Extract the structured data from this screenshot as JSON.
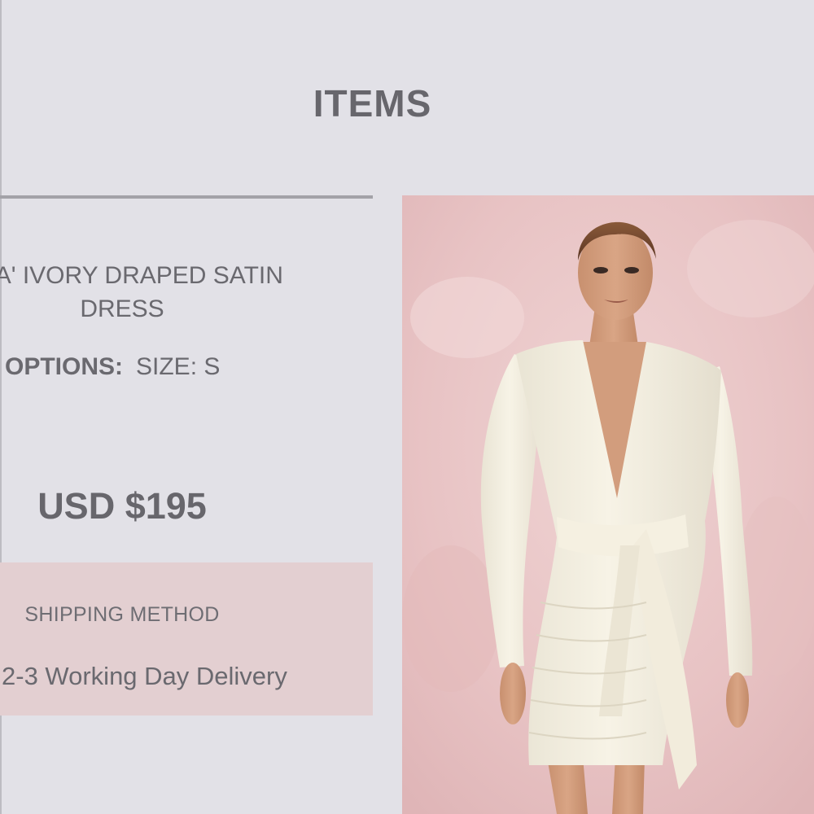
{
  "section": {
    "title": "ITEMS"
  },
  "item": {
    "name_line1": "ANA' IVORY DRAPED SATIN",
    "name_line2": "DRESS",
    "options_label": "OPTIONS:",
    "options_value": "SIZE: S",
    "price": "USD $195",
    "image_icon": "product-photo"
  },
  "shipping": {
    "title": "SHIPPING METHOD",
    "value": "2-3 Working Day Delivery"
  },
  "colors": {
    "background": "#e2e1e7",
    "text": "#67666c",
    "shipping_box": "#e3cfd1",
    "image_background": "#e9c7c8"
  }
}
